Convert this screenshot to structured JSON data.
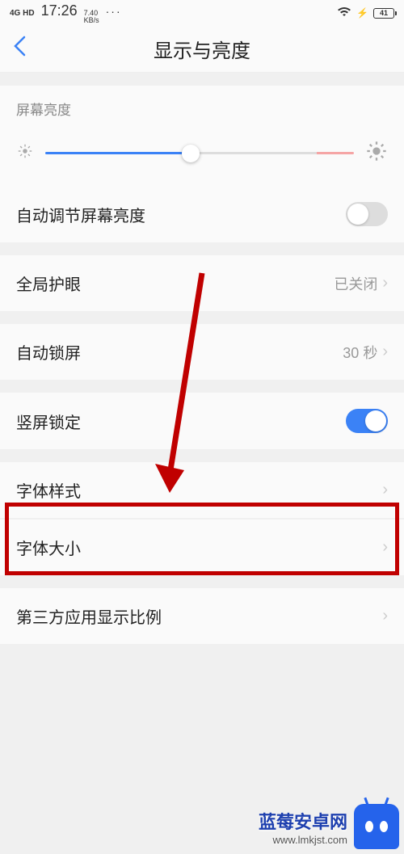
{
  "status": {
    "signal": "4G HD",
    "time": "17:26",
    "speed_value": "7.40",
    "speed_unit": "KB/s",
    "dots": "···",
    "battery": "41"
  },
  "nav": {
    "title": "显示与亮度"
  },
  "brightness": {
    "label": "屏幕亮度",
    "auto_label": "自动调节屏幕亮度",
    "slider_percent": 47
  },
  "rows": {
    "eye_care": {
      "label": "全局护眼",
      "value": "已关闭"
    },
    "auto_lock": {
      "label": "自动锁屏",
      "value": "30 秒"
    },
    "portrait_lock": {
      "label": "竖屏锁定"
    },
    "font_style": {
      "label": "字体样式"
    },
    "font_size": {
      "label": "字体大小"
    },
    "third_party": {
      "label": "第三方应用显示比例"
    }
  },
  "watermark": {
    "name": "蓝莓安卓网",
    "url": "www.lmkjst.com"
  }
}
